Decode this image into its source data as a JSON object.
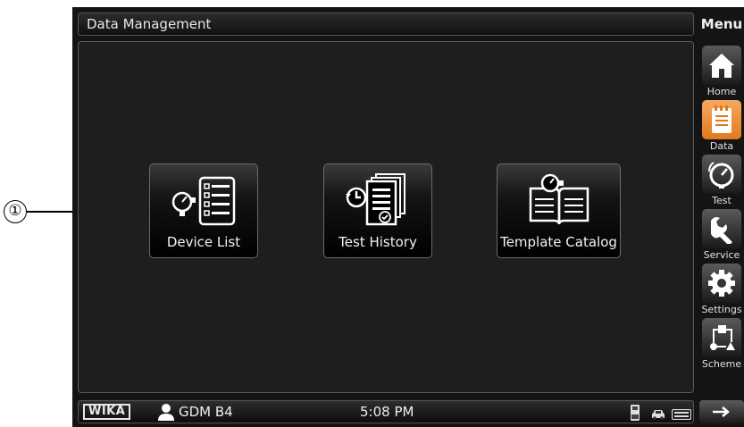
{
  "callout": {
    "number": "①"
  },
  "titlebar": {
    "title": "Data Management"
  },
  "tiles": [
    {
      "label": "Device List",
      "icon": "gauge-list-icon"
    },
    {
      "label": "Test History",
      "icon": "history-documents-icon"
    },
    {
      "label": "Template Catalog",
      "icon": "gauge-book-icon"
    }
  ],
  "menu": {
    "title": "Menu",
    "items": [
      {
        "label": "Home",
        "icon": "home-icon",
        "active": false
      },
      {
        "label": "Data",
        "icon": "data-notepad-icon",
        "active": true
      },
      {
        "label": "Test",
        "icon": "test-gauge-icon",
        "active": false
      },
      {
        "label": "Service",
        "icon": "wrench-icon",
        "active": false
      },
      {
        "label": "Settings",
        "icon": "gear-icon",
        "active": false
      },
      {
        "label": "Scheme",
        "icon": "scheme-icon",
        "active": false
      }
    ]
  },
  "statusbar": {
    "logo": "WIKA",
    "user": "GDM B4",
    "time": "5:08 PM",
    "icons": [
      "usb-icon",
      "car-icon",
      "keyboard-icon"
    ]
  },
  "colors": {
    "accent": "#e8892b",
    "background": "#1e1e1e"
  }
}
